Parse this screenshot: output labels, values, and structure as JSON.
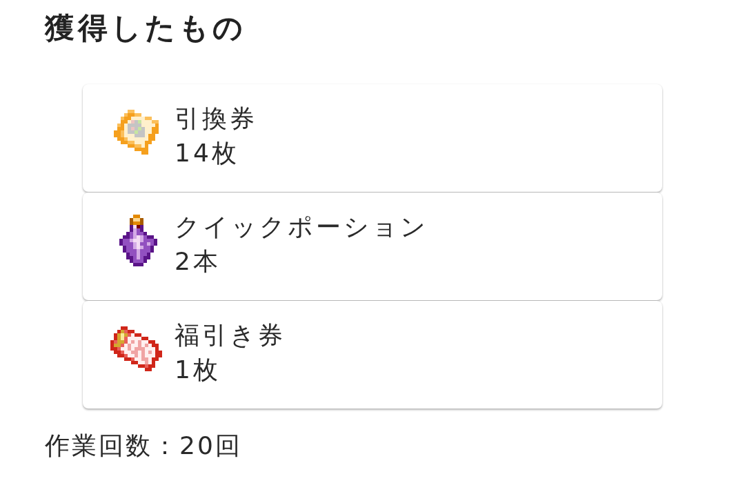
{
  "title": "獲得したもの",
  "items": [
    {
      "kind": "voucher",
      "name": "引換券",
      "quantity": "14枚"
    },
    {
      "kind": "potion",
      "name": "クイックポーション",
      "quantity": "2本"
    },
    {
      "kind": "raffle",
      "name": "福引き券",
      "quantity": "1枚"
    }
  ],
  "work_count": "作業回数：20回"
}
